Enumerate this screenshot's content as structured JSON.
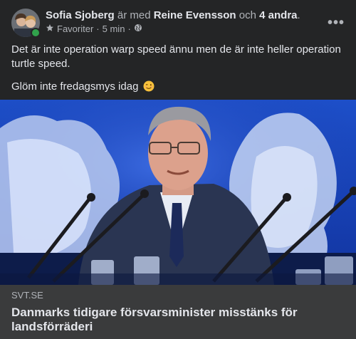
{
  "post": {
    "author": "Sofia Sjoberg",
    "with_text": "är med",
    "tagged": "Reine Evensson",
    "and_text": "och",
    "others": "4 andra",
    "end_punct": ".",
    "audience_label": "Favoriter",
    "separator": "·",
    "time": "5 min",
    "separator2": "·",
    "more_label": "•••",
    "body_line1": "Det är inte operation warp speed ännu men de är inte heller operation turtle speed.",
    "body_line2": "Glöm inte fredagsmys idag",
    "emoji": "winking-face"
  },
  "link_preview": {
    "domain": "SVT.SE",
    "title": "Danmarks tidigare försvarsminister misstänks för landsförräderi"
  },
  "colors": {
    "background": "#242526",
    "caption_bg": "#3a3b3c",
    "text_primary": "#e4e6eb",
    "text_secondary": "#b0b3b8",
    "online": "#31a24c"
  }
}
